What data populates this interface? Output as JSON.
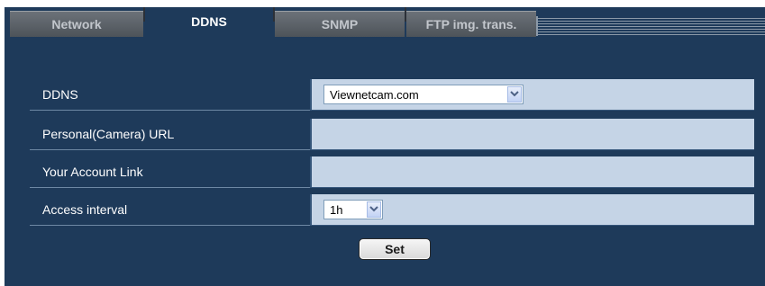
{
  "tabs": [
    {
      "label": "Network",
      "active": false
    },
    {
      "label": "DDNS",
      "active": true
    },
    {
      "label": "SNMP",
      "active": false
    },
    {
      "label": "FTP img. trans.",
      "active": false
    }
  ],
  "settings": {
    "ddns": {
      "label": "DDNS",
      "value": "Viewnetcam.com"
    },
    "personal_url": {
      "label": "Personal(Camera) URL",
      "value": ""
    },
    "account_link": {
      "label": "Your Account Link",
      "value": ""
    },
    "access_interval": {
      "label": "Access interval",
      "value": "1h"
    }
  },
  "set_button": {
    "label": "Set"
  },
  "colors": {
    "panel": "#1e3a5a",
    "value_cell": "#c5d4e6",
    "inactive_tab": "#5a6067"
  }
}
